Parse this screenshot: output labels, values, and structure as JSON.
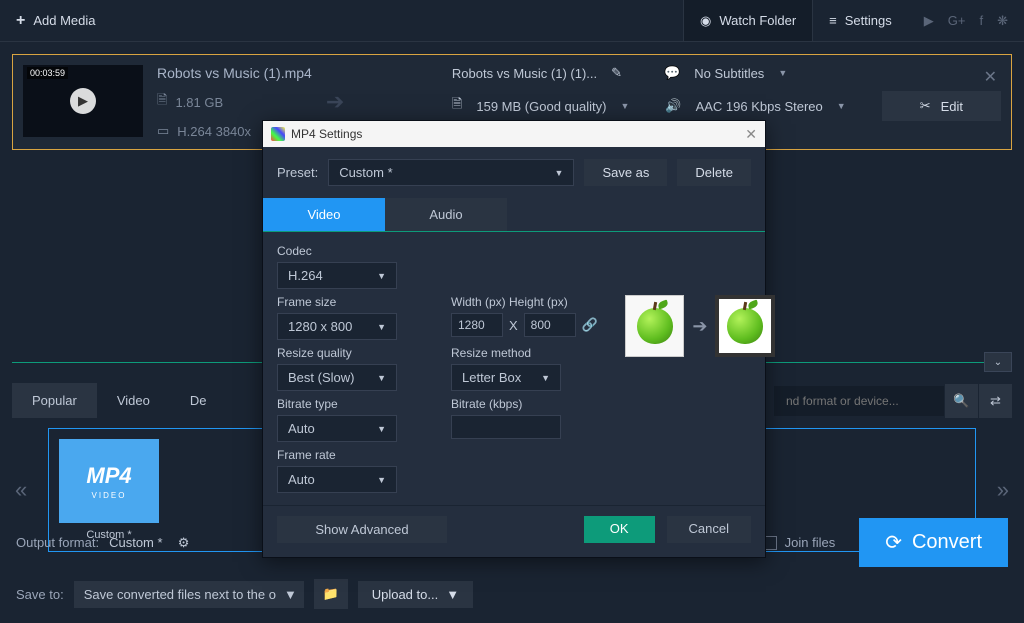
{
  "topbar": {
    "add_media": "Add Media",
    "watch_folder": "Watch Folder",
    "settings": "Settings"
  },
  "file": {
    "title": "Robots vs Music (1).mp4",
    "timestamp": "00:03:59",
    "size": "1.81 GB",
    "codec": "H.264 3840x",
    "out_name": "Robots vs Music (1) (1)...",
    "subtitles": "No Subtitles",
    "out_size": "159 MB (Good quality)",
    "audio": "AAC 196 Kbps Stereo",
    "edit": "Edit"
  },
  "format_tabs": [
    "Popular",
    "Video",
    "De"
  ],
  "search_placeholder": "nd format or device...",
  "preset_tile": {
    "name": "MP4",
    "sub": "VIDEO",
    "label": "Custom *"
  },
  "bottom": {
    "output_format_lbl": "Output format:",
    "output_format_val": "Custom *",
    "save_to_lbl": "Save to:",
    "save_to_val": "Save converted files next to the o",
    "upload": "Upload to...",
    "join_files": "Join files",
    "convert": "Convert"
  },
  "dialog": {
    "title": "MP4 Settings",
    "preset_lbl": "Preset:",
    "preset_val": "Custom *",
    "save_as": "Save as",
    "delete": "Delete",
    "tabs": {
      "video": "Video",
      "audio": "Audio"
    },
    "codec_lbl": "Codec",
    "codec_val": "H.264",
    "framesize_lbl": "Frame size",
    "framesize_val": "1280 x 800",
    "wh_lbl": "Width (px) Height (px)",
    "width": "1280",
    "x": "X",
    "height": "800",
    "rq_lbl": "Resize quality",
    "rq_val": "Best (Slow)",
    "rm_lbl": "Resize method",
    "rm_val": "Letter Box",
    "bt_lbl": "Bitrate type",
    "bt_val": "Auto",
    "br_lbl": "Bitrate (kbps)",
    "br_val": "",
    "fr_lbl": "Frame rate",
    "fr_val": "Auto",
    "show_adv": "Show Advanced",
    "ok": "OK",
    "cancel": "Cancel"
  }
}
